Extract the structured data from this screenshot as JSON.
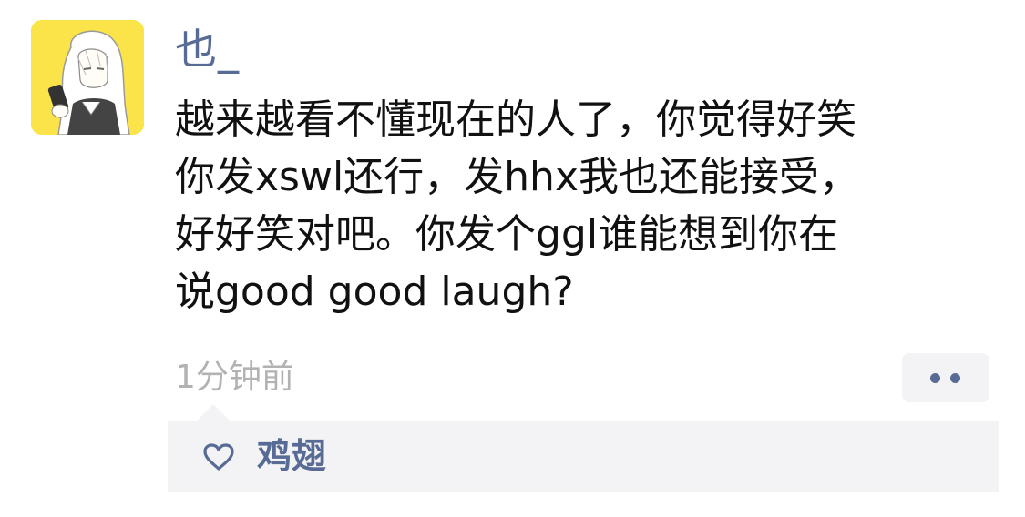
{
  "post": {
    "username": "也_",
    "lines": [
      "越来越看不懂现在的人了，你觉得好笑",
      "你发xswl还行，发hhx我也还能接受，",
      "好好笑对吧。你发个ggl谁能想到你在",
      "说good good laugh?"
    ],
    "timestamp": "1分钟前"
  },
  "actions": {
    "more_icon": "two-dots-icon"
  },
  "likes": {
    "icon": "heart-outline-icon",
    "names": "鸡翅"
  },
  "colors": {
    "link": "#576b95",
    "text": "#111111",
    "muted": "#b2b2b2",
    "panel": "#f3f3f5",
    "avatar_bg": "#fbe44a"
  }
}
